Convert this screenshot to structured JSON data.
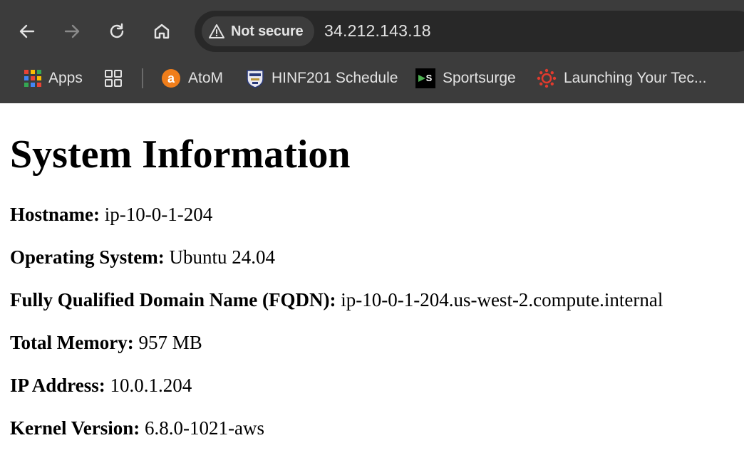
{
  "browser": {
    "security_label": "Not secure",
    "url": "34.212.143.18",
    "nav": {
      "back_icon": "arrow-left-icon",
      "forward_icon": "arrow-right-icon",
      "reload_icon": "reload-icon",
      "home_icon": "home-icon"
    },
    "bookmarks": [
      {
        "label": "Apps",
        "icon": "apps-grid-icon"
      },
      {
        "label": "",
        "icon": "tab-groups-icon"
      },
      {
        "label": "AtoM",
        "icon": "atom-logo-icon"
      },
      {
        "label": "HINF201 Schedule",
        "icon": "university-crest-icon"
      },
      {
        "label": "Sportsurge",
        "icon": "sportsurge-logo-icon"
      },
      {
        "label": "Launching Your Tec...",
        "icon": "canvas-logo-icon"
      }
    ]
  },
  "page": {
    "title": "System Information",
    "rows": [
      {
        "key": "Hostname:",
        "value": " ip-10-0-1-204"
      },
      {
        "key": "Operating System:",
        "value": " Ubuntu 24.04"
      },
      {
        "key": "Fully Qualified Domain Name (FQDN):",
        "value": " ip-10-0-1-204.us-west-2.compute.internal"
      },
      {
        "key": "Total Memory:",
        "value": " 957 MB"
      },
      {
        "key": "IP Address:",
        "value": " 10.0.1.204"
      },
      {
        "key": "Kernel Version:",
        "value": " 6.8.0-1021-aws"
      }
    ]
  },
  "colors": {
    "chrome_bg": "#3c3c3c",
    "omnibox_bg": "#282828",
    "chrome_text": "#e3e3e3",
    "page_bg": "#ffffff"
  }
}
